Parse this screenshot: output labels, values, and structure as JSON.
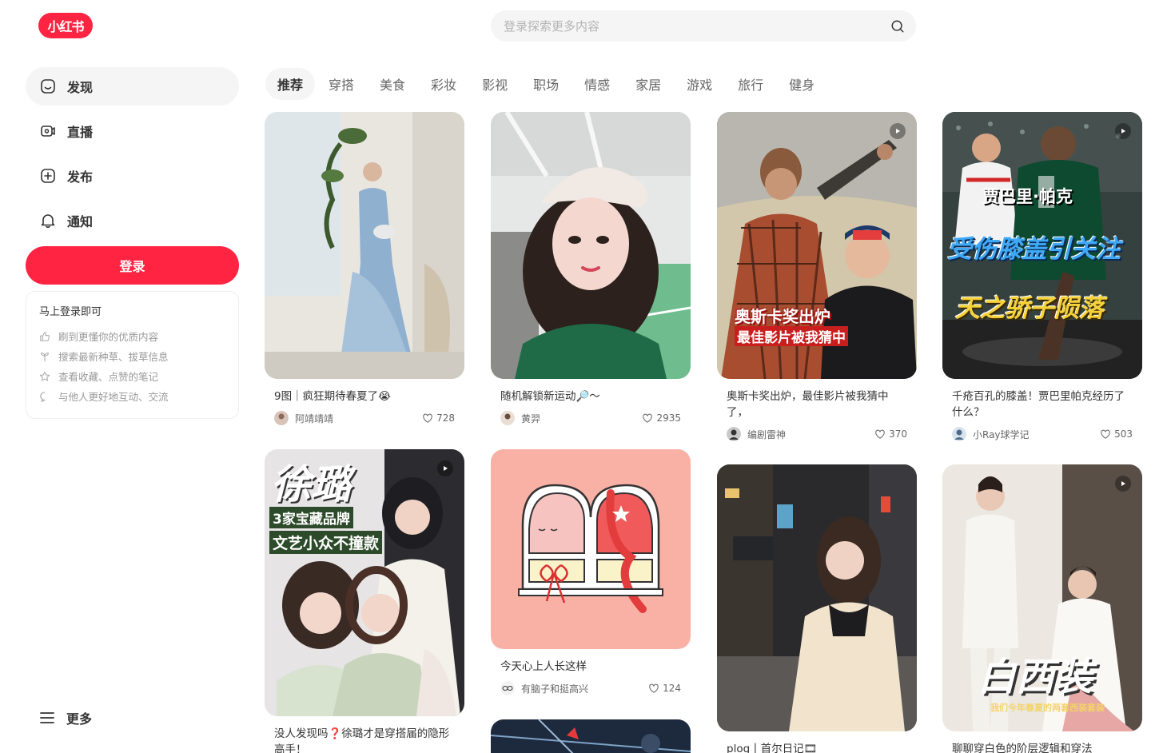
{
  "app": {
    "logo_text": "小红书",
    "brand_color": "#ff2442"
  },
  "search": {
    "placeholder": "登录探索更多内容"
  },
  "sidebar": {
    "items": [
      {
        "label": "发现",
        "icon": "home-icon"
      },
      {
        "label": "直播",
        "icon": "live-icon"
      },
      {
        "label": "发布",
        "icon": "plus-icon"
      },
      {
        "label": "通知",
        "icon": "bell-icon"
      }
    ],
    "login_label": "登录",
    "login_card": {
      "title": "马上登录即可",
      "benefits": [
        "刷到更懂你的优质内容",
        "搜索最新种草、拔草信息",
        "查看收藏、点赞的笔记",
        "与他人更好地互动、交流"
      ]
    },
    "more_label": "更多"
  },
  "tabs": [
    "推荐",
    "穿搭",
    "美食",
    "彩妆",
    "影视",
    "职场",
    "情感",
    "家居",
    "游戏",
    "旅行",
    "健身"
  ],
  "feed": [
    {
      "title": "9图｜疯狂期待春夏了😭",
      "author": "阿靖靖靖",
      "likes": "728"
    },
    {
      "title": "随机解锁新运动🔎～",
      "author": "黄羿",
      "likes": "2935"
    },
    {
      "title": "奥斯卡奖出炉，最佳影片被我猜中了，",
      "author": "编剧雷神",
      "likes": "370",
      "overlay": [
        "奥斯卡奖出炉",
        "最佳影片被我猜中"
      ]
    },
    {
      "title": "千疮百孔的膝盖！贾巴里帕克经历了什么？",
      "author": "小Ray球学记",
      "likes": "503",
      "overlay": [
        "贾巴里·帕克",
        "受伤膝盖引关注",
        "天之骄子陨落"
      ]
    },
    {
      "title": "没人发现吗❓徐璐才是穿搭届的隐形高手！",
      "overlay": [
        "徐璐",
        "3家宝藏品牌",
        "文艺小众不撞款"
      ]
    },
    {
      "title": "今天心上人长这样",
      "author": "有脑子和挺高兴",
      "likes": "124"
    },
    {
      "title": "plog丨首尔日记🎞"
    },
    {
      "title": "聊聊穿白色的阶层逻辑和穿法",
      "overlay": [
        "白西装",
        "我们今年春夏的两套西装套装"
      ]
    }
  ]
}
